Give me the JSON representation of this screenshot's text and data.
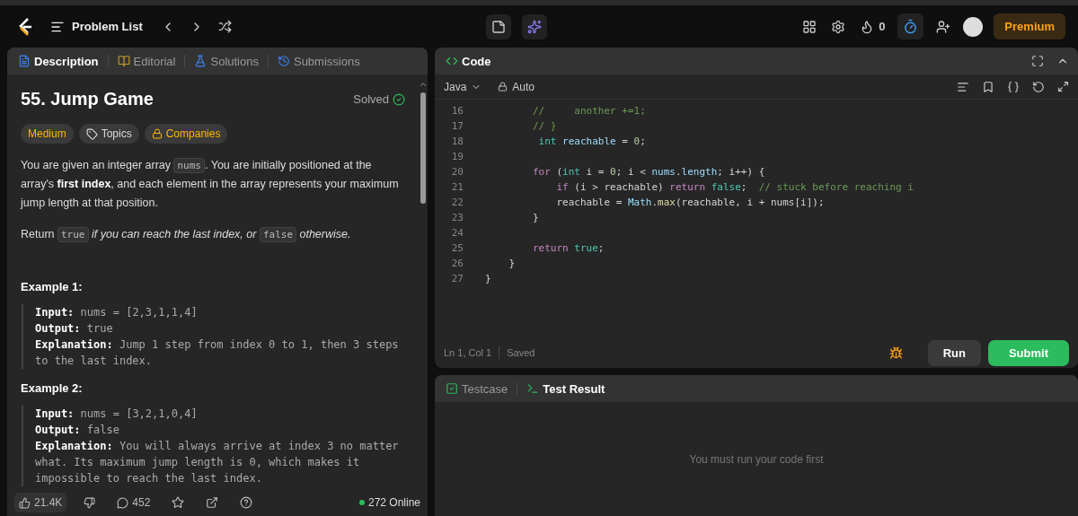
{
  "top_bar": {
    "problem_list": "Problem List",
    "streak": "0",
    "premium": "Premium"
  },
  "description_panel": {
    "tabs": [
      {
        "label": "Description",
        "selected": true
      },
      {
        "label": "Editorial",
        "selected": false
      },
      {
        "label": "Solutions",
        "selected": false
      },
      {
        "label": "Submissions",
        "selected": false
      }
    ],
    "title": "55. Jump Game",
    "status": "Solved",
    "tags": [
      {
        "label": "Medium",
        "kind": "difficulty"
      },
      {
        "label": "Topics",
        "kind": "topics"
      },
      {
        "label": "Companies",
        "kind": "companies"
      }
    ],
    "paragraphs": [
      [
        {
          "kind": "text",
          "text": "You are given an integer array "
        },
        {
          "kind": "code",
          "text": "nums"
        },
        {
          "kind": "text",
          "text": ". You are initially positioned at the array's "
        },
        {
          "kind": "bold",
          "text": "first index"
        },
        {
          "kind": "text",
          "text": ", and each element in the array represents your maximum jump length at that position."
        }
      ],
      [
        {
          "kind": "text",
          "text": "Return "
        },
        {
          "kind": "code",
          "text": "true"
        },
        {
          "kind": "italic",
          "text": " if you can reach the last index, or "
        },
        {
          "kind": "code",
          "text": "false"
        },
        {
          "kind": "italic",
          "text": " otherwise."
        }
      ]
    ],
    "examples": [
      {
        "heading": "Example 1:",
        "lines": [
          {
            "label": "Input:",
            "value": "nums = [2,3,1,1,4]"
          },
          {
            "label": "Output:",
            "value": "true"
          },
          {
            "label": "Explanation:",
            "value": "Jump 1 step from index 0 to 1, then 3 steps to the last index."
          }
        ]
      },
      {
        "heading": "Example 2:",
        "lines": [
          {
            "label": "Input:",
            "value": "nums = [3,2,1,0,4]"
          },
          {
            "label": "Output:",
            "value": "false"
          },
          {
            "label": "Explanation:",
            "value": "You will always arrive at index 3 no matter what. Its maximum jump length is 0, which makes it impossible to reach the last index."
          }
        ]
      }
    ],
    "footer": {
      "likes": "21.4K",
      "comments": "452",
      "online": "272 Online"
    }
  },
  "code_panel": {
    "title": "Code",
    "language": "Java",
    "mode": "Auto",
    "lines": [
      {
        "number": "16",
        "tokens": [
          {
            "kind": "comment",
            "text": "        //     another +=1;"
          }
        ]
      },
      {
        "number": "17",
        "tokens": [
          {
            "kind": "comment",
            "text": "        // }"
          }
        ]
      },
      {
        "number": "18",
        "tokens": [
          {
            "kind": "type",
            "text": "         int"
          },
          {
            "kind": "var",
            "text": " reachable"
          },
          {
            "kind": "plain",
            "text": " = "
          },
          {
            "kind": "number",
            "text": "0"
          },
          {
            "kind": "plain",
            "text": ";"
          }
        ]
      },
      {
        "number": "19"
      },
      {
        "number": "20",
        "tokens": [
          {
            "kind": "keyword",
            "text": "        for"
          },
          {
            "kind": "plain",
            "text": " ("
          },
          {
            "kind": "type",
            "text": "int"
          },
          {
            "kind": "plain",
            "text": " i = "
          },
          {
            "kind": "number",
            "text": "0"
          },
          {
            "kind": "plain",
            "text": "; i < "
          },
          {
            "kind": "var",
            "text": "nums"
          },
          {
            "kind": "plain",
            "text": "."
          },
          {
            "kind": "var",
            "text": "length"
          },
          {
            "kind": "plain",
            "text": "; i++) {"
          }
        ]
      },
      {
        "number": "21",
        "tokens": [
          {
            "kind": "keyword",
            "text": "            if"
          },
          {
            "kind": "plain",
            "text": " (i > reachable) "
          },
          {
            "kind": "keyword",
            "text": "return"
          },
          {
            "kind": "type",
            "text": " false"
          },
          {
            "kind": "plain",
            "text": ";  "
          },
          {
            "kind": "comment",
            "text": "// stuck before reaching i"
          }
        ]
      },
      {
        "number": "22",
        "tokens": [
          {
            "kind": "plain",
            "text": "            reachable = "
          },
          {
            "kind": "var",
            "text": "Math"
          },
          {
            "kind": "plain",
            "text": "."
          },
          {
            "kind": "func",
            "text": "max"
          },
          {
            "kind": "plain",
            "text": "(reachable, i + nums[i]);"
          }
        ]
      },
      {
        "number": "23",
        "tokens": [
          {
            "kind": "plain",
            "text": "        }"
          }
        ]
      },
      {
        "number": "24"
      },
      {
        "number": "25",
        "tokens": [
          {
            "kind": "keyword",
            "text": "        return"
          },
          {
            "kind": "type",
            "text": " true"
          },
          {
            "kind": "plain",
            "text": ";"
          }
        ]
      },
      {
        "number": "26",
        "tokens": [
          {
            "kind": "plain",
            "text": "    }"
          }
        ]
      },
      {
        "number": "27",
        "tokens": [
          {
            "kind": "plain",
            "text": "}"
          }
        ]
      }
    ],
    "position": "Ln 1, Col 1",
    "saved": "Saved",
    "run": "Run",
    "submit": "Submit"
  },
  "test_panel": {
    "tabs": [
      {
        "label": "Testcase",
        "selected": false
      },
      {
        "label": "Test Result",
        "selected": true
      }
    ],
    "message": "You must run your code first"
  }
}
